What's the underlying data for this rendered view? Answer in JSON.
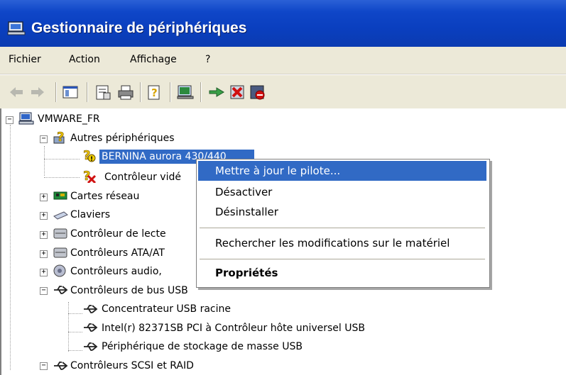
{
  "window": {
    "title": "Gestionnaire de périphériques"
  },
  "menu": {
    "items": [
      "Fichier",
      "Action",
      "Affichage",
      "?"
    ]
  },
  "toolbar": {
    "buttons": [
      "back-arrow-icon",
      "forward-arrow-icon",
      "console-tree-icon",
      "properties-icon",
      "print-icon",
      "help-icon",
      "scan-hardware-icon",
      "update-driver-icon",
      "disable-icon",
      "uninstall-icon"
    ]
  },
  "tree": {
    "root": "VMWARE_FR",
    "other_devices": "Autres périphériques",
    "bernina": "BERNINA aurora 430/440",
    "video_controller": "Contrôleur vidé",
    "network": "Cartes réseau",
    "keyboards": "Claviers",
    "disk_ctrl": "Contrôleur de lecte",
    "ata": "Contrôleurs ATA/AT",
    "audio": "Contrôleurs audio,",
    "usb": "Contrôleurs de bus USB",
    "usb_hub": "Concentrateur USB racine",
    "usb_intel": "Intel(r) 82371SB PCI à Contrôleur hôte universel USB",
    "usb_storage": "Périphérique de stockage de masse USB",
    "scsi": "Contrôleurs SCSI et RAID"
  },
  "context_menu": {
    "update_driver": "Mettre à jour le pilote...",
    "disable": "Désactiver",
    "uninstall": "Désinstaller",
    "scan": "Rechercher les modifications sur le matériel",
    "properties": "Propriétés"
  },
  "colors": {
    "titlebar": "#0a3fbf",
    "selection": "#316ac5",
    "chrome": "#ece9d8"
  }
}
